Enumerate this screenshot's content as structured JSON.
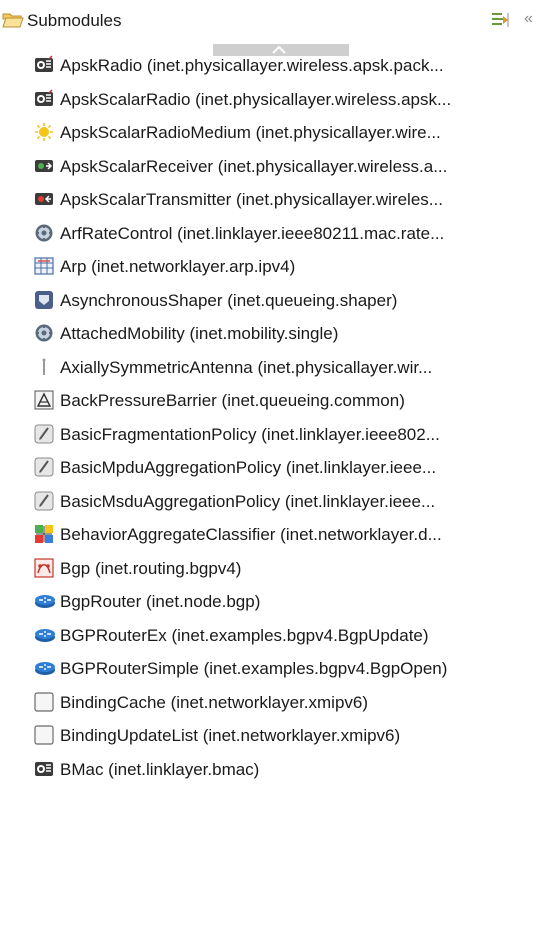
{
  "header": {
    "title": "Submodules",
    "more_glyph": "«"
  },
  "items": [
    {
      "label": "ApskRadio (inet.physicallayer.wireless.apsk.pack...",
      "icon": "radio-icon"
    },
    {
      "label": "ApskScalarRadio (inet.physicallayer.wireless.apsk...",
      "icon": "radio-icon"
    },
    {
      "label": "ApskScalarRadioMedium (inet.physicallayer.wire...",
      "icon": "sun-icon"
    },
    {
      "label": "ApskScalarReceiver (inet.physicallayer.wireless.a...",
      "icon": "receiver-icon"
    },
    {
      "label": "ApskScalarTransmitter (inet.physicallayer.wireles...",
      "icon": "transmitter-icon"
    },
    {
      "label": "ArfRateControl (inet.linklayer.ieee80211.mac.rate...",
      "icon": "gear-icon"
    },
    {
      "label": "Arp (inet.networklayer.arp.ipv4)",
      "icon": "table-icon"
    },
    {
      "label": "AsynchronousShaper (inet.queueing.shaper)",
      "icon": "shaper-icon"
    },
    {
      "label": "AttachedMobility (inet.mobility.single)",
      "icon": "gear-icon"
    },
    {
      "label": "AxiallySymmetricAntenna (inet.physicallayer.wir...",
      "icon": "antenna-icon"
    },
    {
      "label": "BackPressureBarrier (inet.queueing.common)",
      "icon": "barrier-icon"
    },
    {
      "label": "BasicFragmentationPolicy (inet.linklayer.ieee802...",
      "icon": "policy-icon"
    },
    {
      "label": "BasicMpduAggregationPolicy (inet.linklayer.ieee...",
      "icon": "policy-icon"
    },
    {
      "label": "BasicMsduAggregationPolicy (inet.linklayer.ieee...",
      "icon": "policy-icon"
    },
    {
      "label": "BehaviorAggregateClassifier (inet.networklayer.d...",
      "icon": "classifier-icon"
    },
    {
      "label": "Bgp (inet.routing.bgpv4)",
      "icon": "bgp-icon"
    },
    {
      "label": "BgpRouter (inet.node.bgp)",
      "icon": "router-icon"
    },
    {
      "label": "BGPRouterEx (inet.examples.bgpv4.BgpUpdate)",
      "icon": "router-icon"
    },
    {
      "label": "BGPRouterSimple (inet.examples.bgpv4.BgpOpen)",
      "icon": "router-icon"
    },
    {
      "label": "BindingCache (inet.networklayer.xmipv6)",
      "icon": "blank-box-icon"
    },
    {
      "label": "BindingUpdateList (inet.networklayer.xmipv6)",
      "icon": "blank-box-icon"
    },
    {
      "label": "BMac (inet.linklayer.bmac)",
      "icon": "mac-icon"
    }
  ]
}
